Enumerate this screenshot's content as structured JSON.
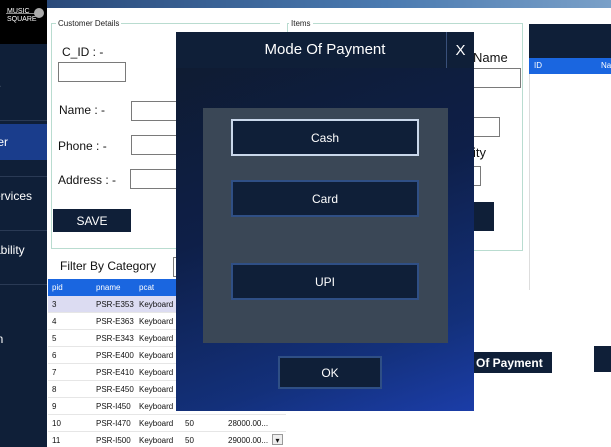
{
  "logo": {
    "line1": "MUSIC",
    "line2": "SQUARE"
  },
  "sidebar": {
    "items": [
      {
        "label": "e"
      },
      {
        "label": "ter"
      },
      {
        "label": "ervices"
      },
      {
        "label": "ability"
      },
      {
        "label": "in"
      }
    ]
  },
  "customer": {
    "title": "Customer Details",
    "cid_label": "C_ID : -",
    "name_label": "Name : -",
    "phone_label": "Phone : -",
    "address_label": "Address : -",
    "save_label": "SAVE"
  },
  "items": {
    "title": "Items",
    "name_label": "Name",
    "qty_label": "ity"
  },
  "filter": {
    "label": "Filter By Category"
  },
  "grid": {
    "columns": [
      "pid",
      "pname",
      "pcat"
    ],
    "rows": [
      {
        "pid": "3",
        "pname": "PSR-E353",
        "pcat": "Keyboard",
        "qty": "",
        "price": ""
      },
      {
        "pid": "4",
        "pname": "PSR-E363",
        "pcat": "Keyboard",
        "qty": "",
        "price": ""
      },
      {
        "pid": "5",
        "pname": "PSR-E343",
        "pcat": "Keyboard",
        "qty": "",
        "price": ""
      },
      {
        "pid": "6",
        "pname": "PSR-E400",
        "pcat": "Keyboard",
        "qty": "",
        "price": ""
      },
      {
        "pid": "7",
        "pname": "PSR-E410",
        "pcat": "Keyboard",
        "qty": "",
        "price": ""
      },
      {
        "pid": "8",
        "pname": "PSR-E450",
        "pcat": "Keyboard",
        "qty": "",
        "price": ""
      },
      {
        "pid": "9",
        "pname": "PSR-I450",
        "pcat": "Keyboard",
        "qty": "",
        "price": ""
      },
      {
        "pid": "10",
        "pname": "PSR-I470",
        "pcat": "Keyboard",
        "qty": "50",
        "price": "28000.00..."
      },
      {
        "pid": "11",
        "pname": "PSR-I500",
        "pcat": "Keyboard",
        "qty": "50",
        "price": "29000.00..."
      }
    ],
    "scroll_glyph": "▾"
  },
  "right_grid": {
    "columns": [
      "ID",
      "Na"
    ]
  },
  "behind_label": "Of Payment",
  "modal": {
    "title": "Mode Of Payment",
    "close_glyph": "X",
    "options": [
      "Cash",
      "Card",
      "UPI"
    ],
    "ok_label": "OK"
  },
  "colors": {
    "sidebar": "#0f1f38",
    "accent": "#1a66e0",
    "active_item": "#1a3d8c"
  }
}
